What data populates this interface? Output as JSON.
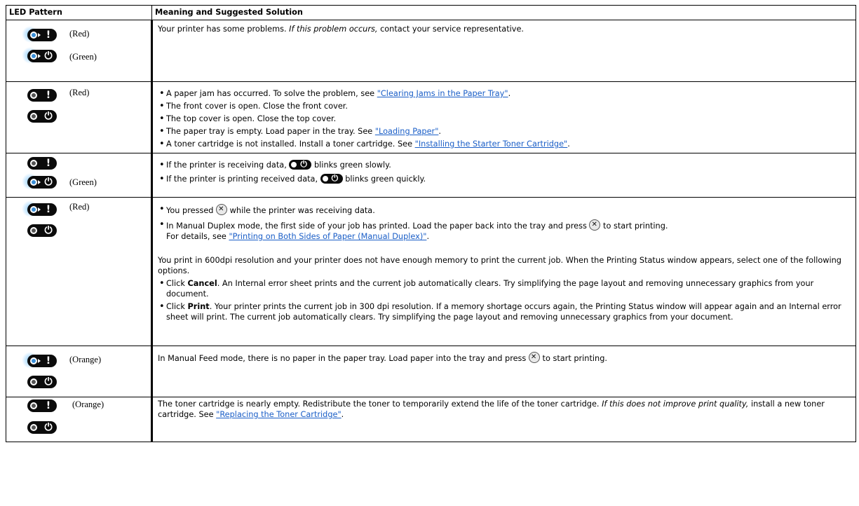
{
  "header": {
    "col1": "LED Pattern",
    "col2": "Meaning and Suggested Solution"
  },
  "rows": [
    {
      "leds": [
        {
          "label": "(Red)",
          "glyph": "!",
          "lit": true
        },
        {
          "label": "(Green)",
          "glyph": "⏻",
          "lit": true
        }
      ],
      "text_a": "Your printer has some problems.",
      "text_em": "If this problem occurs,",
      "text_b": "contact your service representative."
    },
    {
      "leds": [
        {
          "label": "(Red)",
          "glyph": "!",
          "lit": false
        },
        {
          "label": "",
          "glyph": "⏻",
          "lit": false
        }
      ],
      "bullets": [
        {
          "text": "A paper jam has occurred. To solve the problem, see",
          "link": "\"Clearing Jams in the Paper Tray\"",
          "after": "."
        },
        {
          "text": "The front cover is open. Close the front cover.",
          "link": "",
          "after": ""
        },
        {
          "text": "The top cover is open. Close the top cover.",
          "link": "",
          "after": ""
        },
        {
          "text": "The paper tray is empty. Load paper in the tray. See",
          "link": "\"Loading Paper\"",
          "after": "."
        },
        {
          "text": "A toner cartridge is not installed. Install a toner cartridge. See",
          "link": "\"Installing the Starter Toner Cartridge\"",
          "after": "."
        }
      ]
    },
    {
      "leds": [
        {
          "label": "",
          "glyph": "!",
          "lit": false
        },
        {
          "label": "(Green)",
          "glyph": "⏻",
          "lit": true
        }
      ],
      "bullets": [
        {
          "a": "If the printer is receiving data,",
          "b": "blinks green slowly."
        },
        {
          "a": "If the printer is printing received data,",
          "b": "blinks green quickly."
        }
      ]
    },
    {
      "leds": [
        {
          "label": "(Red)",
          "glyph": "!",
          "lit": true
        },
        {
          "label": "",
          "glyph": "⏻",
          "lit": false
        }
      ],
      "b1a": "You pressed",
      "b1b": "while the printer was receiving data.",
      "b2a": "In Manual Duplex mode, the first side of your job has printed. Load the paper back into the tray and press",
      "b2b": "to start printing.",
      "b2c": "For details, see",
      "b2link": "\"Printing on Both Sides of Paper (Manual Duplex)\"",
      "b2d": ".",
      "para": "You print in 600dpi resolution and your printer does not have enough memory to print the current job. When the Printing Status window appears, select one of the following options.",
      "c1a": "Click",
      "c1bold": "Cancel",
      "c1b": ". An Internal error sheet prints and the current job automatically clears. Try simplifying the page layout and removing unnecessary graphics from your document.",
      "c2a": "Click",
      "c2bold": "Print",
      "c2b": ". Your printer prints the current job in 300 dpi resolution. If a memory shortage occurs again, the Printing Status window will appear again and an Internal error sheet will print. The current job automatically clears. Try simplifying the page layout and removing unnecessary graphics from your document."
    },
    {
      "leds": [
        {
          "label": "(Orange)",
          "glyph": "!",
          "lit": true
        },
        {
          "label": "",
          "glyph": "⏻",
          "lit": false
        }
      ],
      "text_a": "In Manual Feed mode, there is no paper in the paper tray. Load paper into the tray and press",
      "text_b": "to start printing."
    },
    {
      "leds": [
        {
          "label": "(Orange)",
          "glyph": "!",
          "lit": false
        },
        {
          "label": "",
          "glyph": "⏻",
          "lit": false
        }
      ],
      "text_a": "The toner cartridge is nearly empty. Redistribute the toner to temporarily extend the life of the toner cartridge.",
      "text_em": "If this does not improve print quality,",
      "text_b": "install a new toner cartridge. See",
      "link": "\"Replacing the Toner Cartridge\"",
      "after": "."
    }
  ]
}
